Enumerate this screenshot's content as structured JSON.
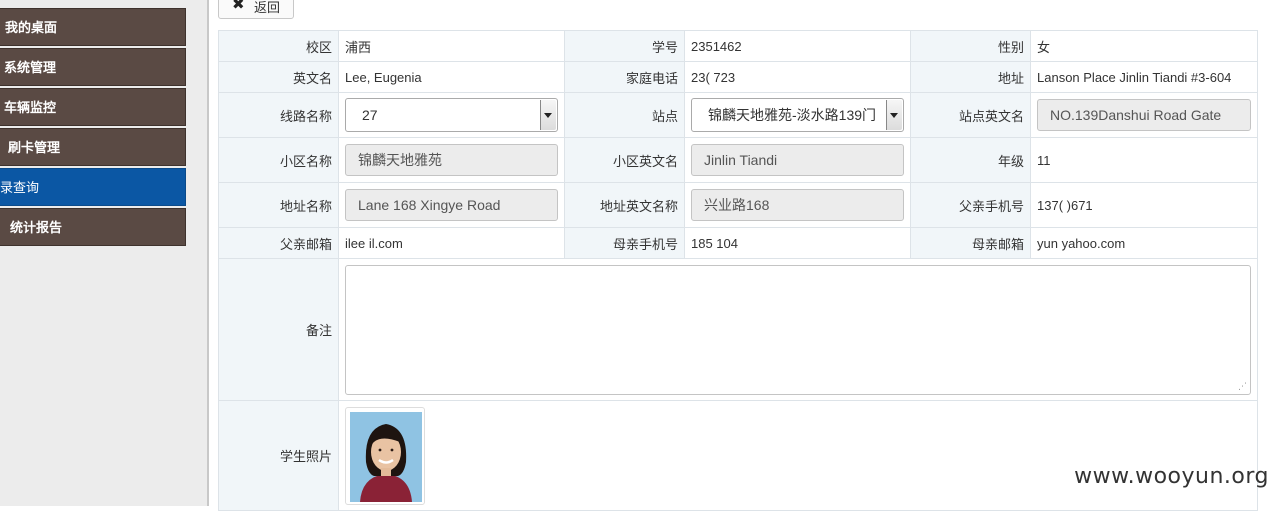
{
  "sidebar": {
    "items": [
      {
        "label": "我的桌面"
      },
      {
        "label": "系统管理"
      },
      {
        "label": "车辆监控"
      },
      {
        "label": "刷卡管理"
      },
      {
        "label": "记录查询",
        "active": true
      },
      {
        "label": "统计报告"
      }
    ]
  },
  "back_button": {
    "label": "返回",
    "icon": "close-icon"
  },
  "form": {
    "campus": {
      "label": "校区",
      "value": "浦西"
    },
    "student_id": {
      "label": "学号",
      "value": "2351462"
    },
    "gender": {
      "label": "性别",
      "value": "女"
    },
    "english_name": {
      "label": "英文名",
      "value": "Lee, Eugenia"
    },
    "home_phone": {
      "label": "家庭电话",
      "value": "23(       723"
    },
    "address": {
      "label": "地址",
      "value": "Lanson Place Jinlin Tiandi #3-604"
    },
    "route_name": {
      "label": "线路名称",
      "value": "27"
    },
    "stop": {
      "label": "站点",
      "value": "锦麟天地雅苑-淡水路139门"
    },
    "stop_english": {
      "label": "站点英文名",
      "value": "NO.139Danshui Road Gate"
    },
    "community": {
      "label": "小区名称",
      "value": "锦麟天地雅苑"
    },
    "community_english": {
      "label": "小区英文名",
      "value": "Jinlin Tiandi"
    },
    "grade": {
      "label": "年级",
      "value": "11"
    },
    "address_name": {
      "label": "地址名称",
      "value": "Lane 168 Xingye Road"
    },
    "address_english": {
      "label": "地址英文名称",
      "value": "兴业路168"
    },
    "father_mobile": {
      "label": "父亲手机号",
      "value": "137(        )671"
    },
    "father_email": {
      "label": "父亲邮箱",
      "value": "ilee               il.com"
    },
    "mother_mobile": {
      "label": "母亲手机号",
      "value": "185               104"
    },
    "mother_email": {
      "label": "母亲邮箱",
      "value": "yun               yahoo.com"
    },
    "remark": {
      "label": "备注",
      "value": ""
    },
    "photo": {
      "label": "学生照片"
    }
  },
  "watermark": "www.wooyun.org",
  "colors": {
    "sidebar_item": "#5a4a44",
    "sidebar_active": "#0b57a4",
    "label_bg": "#f1f6f9",
    "readonly_bg": "#ececec"
  }
}
